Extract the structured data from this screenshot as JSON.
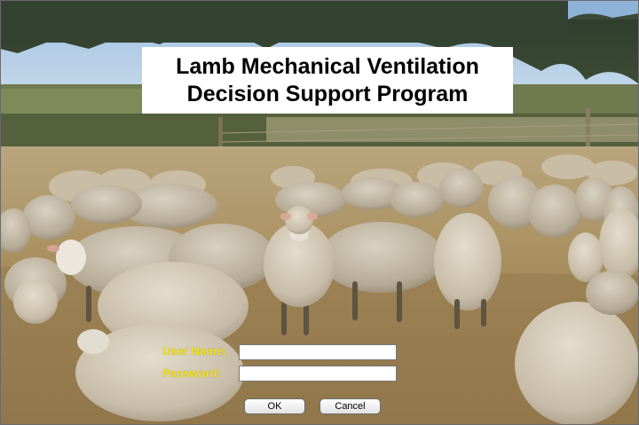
{
  "title": {
    "line1": "Lamb Mechanical Ventilation",
    "line2": "Decision Support Program"
  },
  "login": {
    "username_label": "User Name:",
    "username_value": "",
    "password_label": "Password:",
    "password_value": ""
  },
  "buttons": {
    "ok": "OK",
    "cancel": "Cancel"
  },
  "colors": {
    "label": "#f2e21a",
    "title_bg": "#ffffff",
    "sky": "#a9c7e6",
    "field_grass": "#b89b62"
  },
  "background": {
    "subject": "flock-of-sheep-photo"
  }
}
